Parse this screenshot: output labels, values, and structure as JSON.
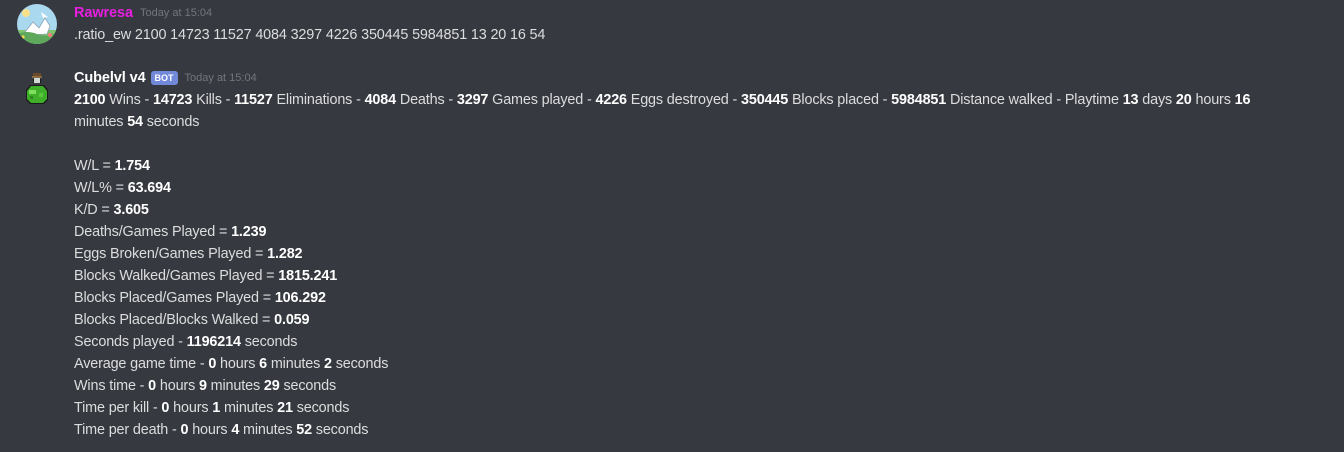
{
  "messages": [
    {
      "username": "Rawresa",
      "username_color": "#e91ee3",
      "timestamp": "Today at 15:04",
      "text": ".ratio_ew 2100 14723 11527 4084 3297 4226 350445 5984851 13 20 16 54"
    },
    {
      "username": "Cubelvl v4",
      "username_color": "#ffffff",
      "bot_tag": "BOT",
      "timestamp": "Today at 15:04",
      "summary": {
        "p1": "2100",
        "t1": " Wins - ",
        "p2": "14723",
        "t2": " Kills - ",
        "p3": "11527",
        "t3": " Eliminations - ",
        "p4": "4084",
        "t4": " Deaths - ",
        "p5": "3297",
        "t5": " Games played - ",
        "p6": "4226",
        "t6": " Eggs destroyed - ",
        "p7": "350445",
        "t7": " Blocks placed - ",
        "p8": "5984851",
        "t8": " Distance walked - Playtime ",
        "p9": "13",
        "t9": " days ",
        "p10": "20",
        "t10": " hours ",
        "p11": "16",
        "t11": " minutes ",
        "p12": "54",
        "t12": " seconds"
      },
      "stats": [
        {
          "label": "W/L = ",
          "value": "1.754"
        },
        {
          "label": "W/L% = ",
          "value": "63.694"
        },
        {
          "label": "K/D = ",
          "value": "3.605"
        },
        {
          "label": "Deaths/Games Played = ",
          "value": "1.239"
        },
        {
          "label": "Eggs Broken/Games Played = ",
          "value": "1.282"
        },
        {
          "label": "Blocks Walked/Games Played = ",
          "value": "1815.241"
        },
        {
          "label": "Blocks Placed/Games Played = ",
          "value": "106.292"
        },
        {
          "label": "Blocks Placed/Blocks Walked = ",
          "value": "0.059"
        },
        {
          "label": "Seconds played - ",
          "value": "1196214",
          "suffix": " seconds"
        }
      ],
      "times": [
        {
          "label": "Average game time - ",
          "h": "0",
          "m": "6",
          "s": "2"
        },
        {
          "label": "Wins time - ",
          "h": "0",
          "m": "9",
          "s": "29"
        },
        {
          "label": "Time per kill - ",
          "h": "0",
          "m": "1",
          "s": "21"
        },
        {
          "label": "Time per death - ",
          "h": "0",
          "m": "4",
          "s": "52"
        }
      ],
      "units": {
        "hours": " hours ",
        "minutes": " minutes ",
        "seconds": " seconds"
      }
    }
  ]
}
